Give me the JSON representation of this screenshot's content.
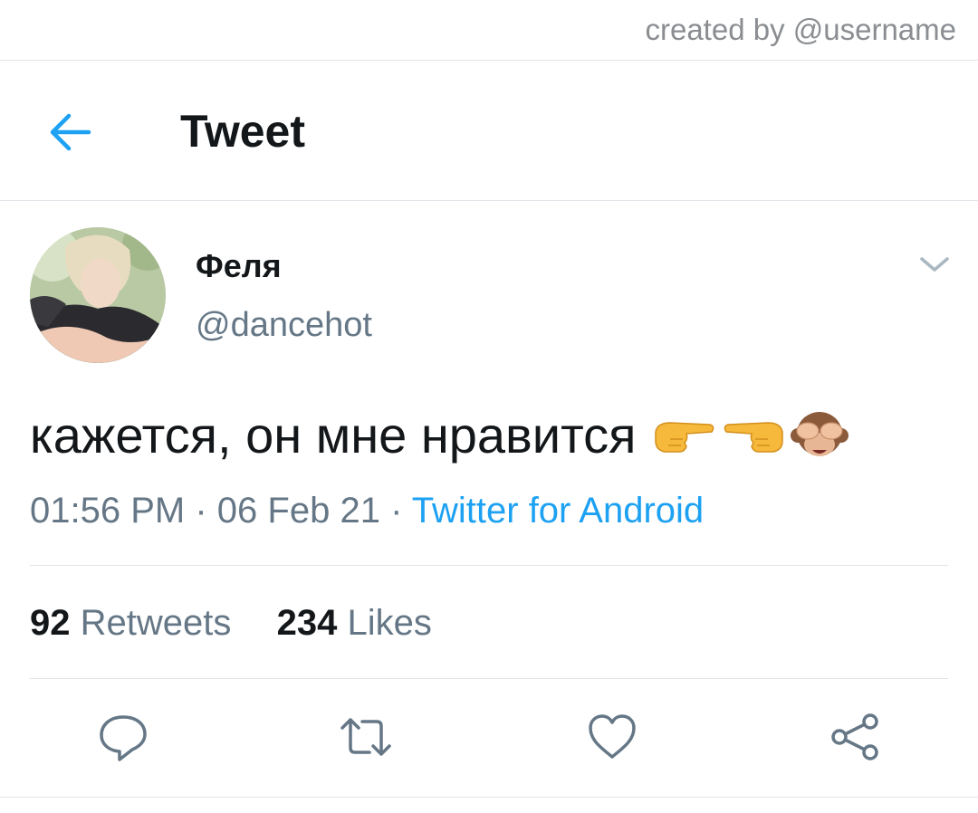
{
  "watermark": {
    "text": "created by @username"
  },
  "header": {
    "back_icon": "arrow-left-icon",
    "title": "Tweet"
  },
  "tweet": {
    "author": {
      "display_name": "Феля",
      "handle": "@dancehot",
      "avatar_icon": "profile-photo"
    },
    "menu_icon": "chevron-down-icon",
    "text": "кажется, он мне нравится",
    "emojis": [
      "pointing-right-emoji",
      "pointing-left-emoji",
      "see-no-evil-monkey-emoji"
    ],
    "time": "01:56 PM",
    "separator": "·",
    "date": "06 Feb 21",
    "source": "Twitter for Android",
    "stats": {
      "retweets_count": "92",
      "retweets_label": "Retweets",
      "likes_count": "234",
      "likes_label": "Likes"
    },
    "actions": [
      "reply-icon",
      "retweet-icon",
      "like-icon",
      "share-icon"
    ]
  },
  "colors": {
    "accent": "#1da1f2",
    "text_primary": "#14171a",
    "text_secondary": "#657786",
    "divider": "#e1e4e8"
  }
}
